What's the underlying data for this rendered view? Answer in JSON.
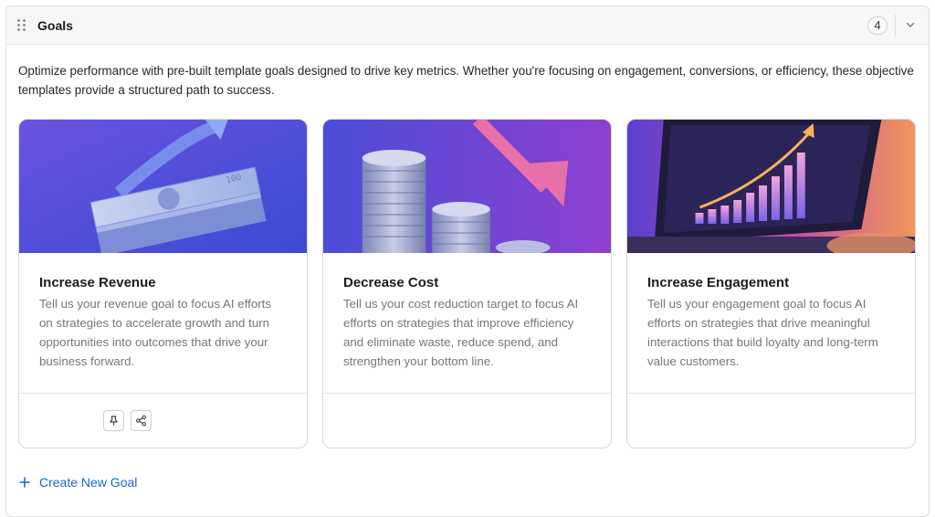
{
  "header": {
    "title": "Goals",
    "count": "4"
  },
  "description": "Optimize performance with pre-built template goals designed to drive key metrics. Whether you're focusing on engagement, conversions, or efficiency, these objective templates provide a structured path to success.",
  "cards": [
    {
      "title": "Increase Revenue",
      "text": "Tell us your revenue goal to focus AI efforts on strategies to accelerate growth and turn opportunities into outcomes that drive your business forward.",
      "image_icon": "money-stack-arrow-up",
      "actions": [
        "pin-icon",
        "share-icon"
      ]
    },
    {
      "title": "Decrease Cost",
      "text": "Tell us your cost reduction target to focus AI efforts on strategies that improve efficiency and eliminate waste, reduce spend, and strengthen your bottom line.",
      "image_icon": "coin-stacks-arrow-down"
    },
    {
      "title": "Increase Engagement",
      "text": "Tell us your engagement goal to focus AI efforts on strategies that drive meaningful interactions that build loyalty and long-term value customers.",
      "image_icon": "laptop-bar-chart"
    }
  ],
  "create_goal": {
    "label": "Create New Goal"
  },
  "colors": {
    "accent": "#1a66d6",
    "card_gradient_blue": "#4a4fd8",
    "card_gradient_purple": "#8a3fd0",
    "card_gradient_orange": "#f08a4b"
  }
}
